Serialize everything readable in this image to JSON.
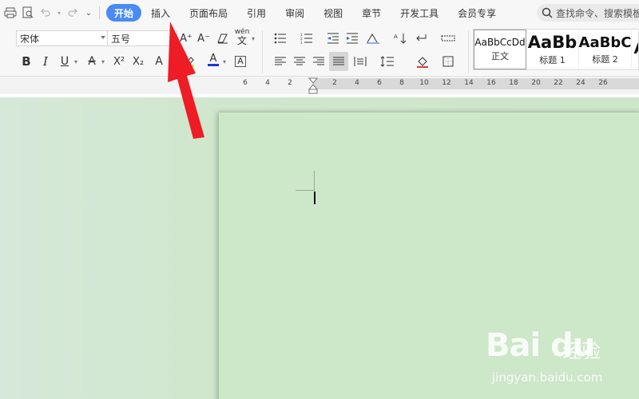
{
  "menu": {
    "tabs": [
      {
        "label": "开始",
        "active": true
      },
      {
        "label": "插入"
      },
      {
        "label": "页面布局"
      },
      {
        "label": "引用"
      },
      {
        "label": "审阅"
      },
      {
        "label": "视图"
      },
      {
        "label": "章节"
      },
      {
        "label": "开发工具"
      },
      {
        "label": "会员专享"
      }
    ],
    "search_placeholder": "查找命令、搜索模板"
  },
  "toolbar": {
    "font_name": "宋体",
    "font_size": "五号",
    "bold": "B",
    "italic": "I",
    "underline": "U",
    "font_color_letter": "A",
    "superscript": "X²",
    "subscript": "X₂",
    "text_effect": "A",
    "highlight_letter": "A",
    "char_border": "A",
    "grow_font": "A⁺",
    "shrink_font": "A⁻",
    "phonetic": "wén"
  },
  "styles": [
    {
      "sample": "AaBbCcDd",
      "name": "正文"
    },
    {
      "sample": "AaBb",
      "name": "标题 1"
    },
    {
      "sample": "AaBbC",
      "name": "标题 2"
    },
    {
      "sample": "A",
      "name": ""
    }
  ],
  "ruler": {
    "labels": [
      "6",
      "4",
      "2",
      "2",
      "4",
      "6",
      "8",
      "10",
      "12",
      "14",
      "16",
      "18",
      "20",
      "22",
      "24",
      "26"
    ]
  },
  "watermark": {
    "logo": "Bai du",
    "cn": "经验",
    "url": "jingyan.baidu.com"
  },
  "colors": {
    "accent": "#4a8af4",
    "arrow": "#ee1c25",
    "canvas": "#cce6c8",
    "page": "#cde7c9"
  }
}
